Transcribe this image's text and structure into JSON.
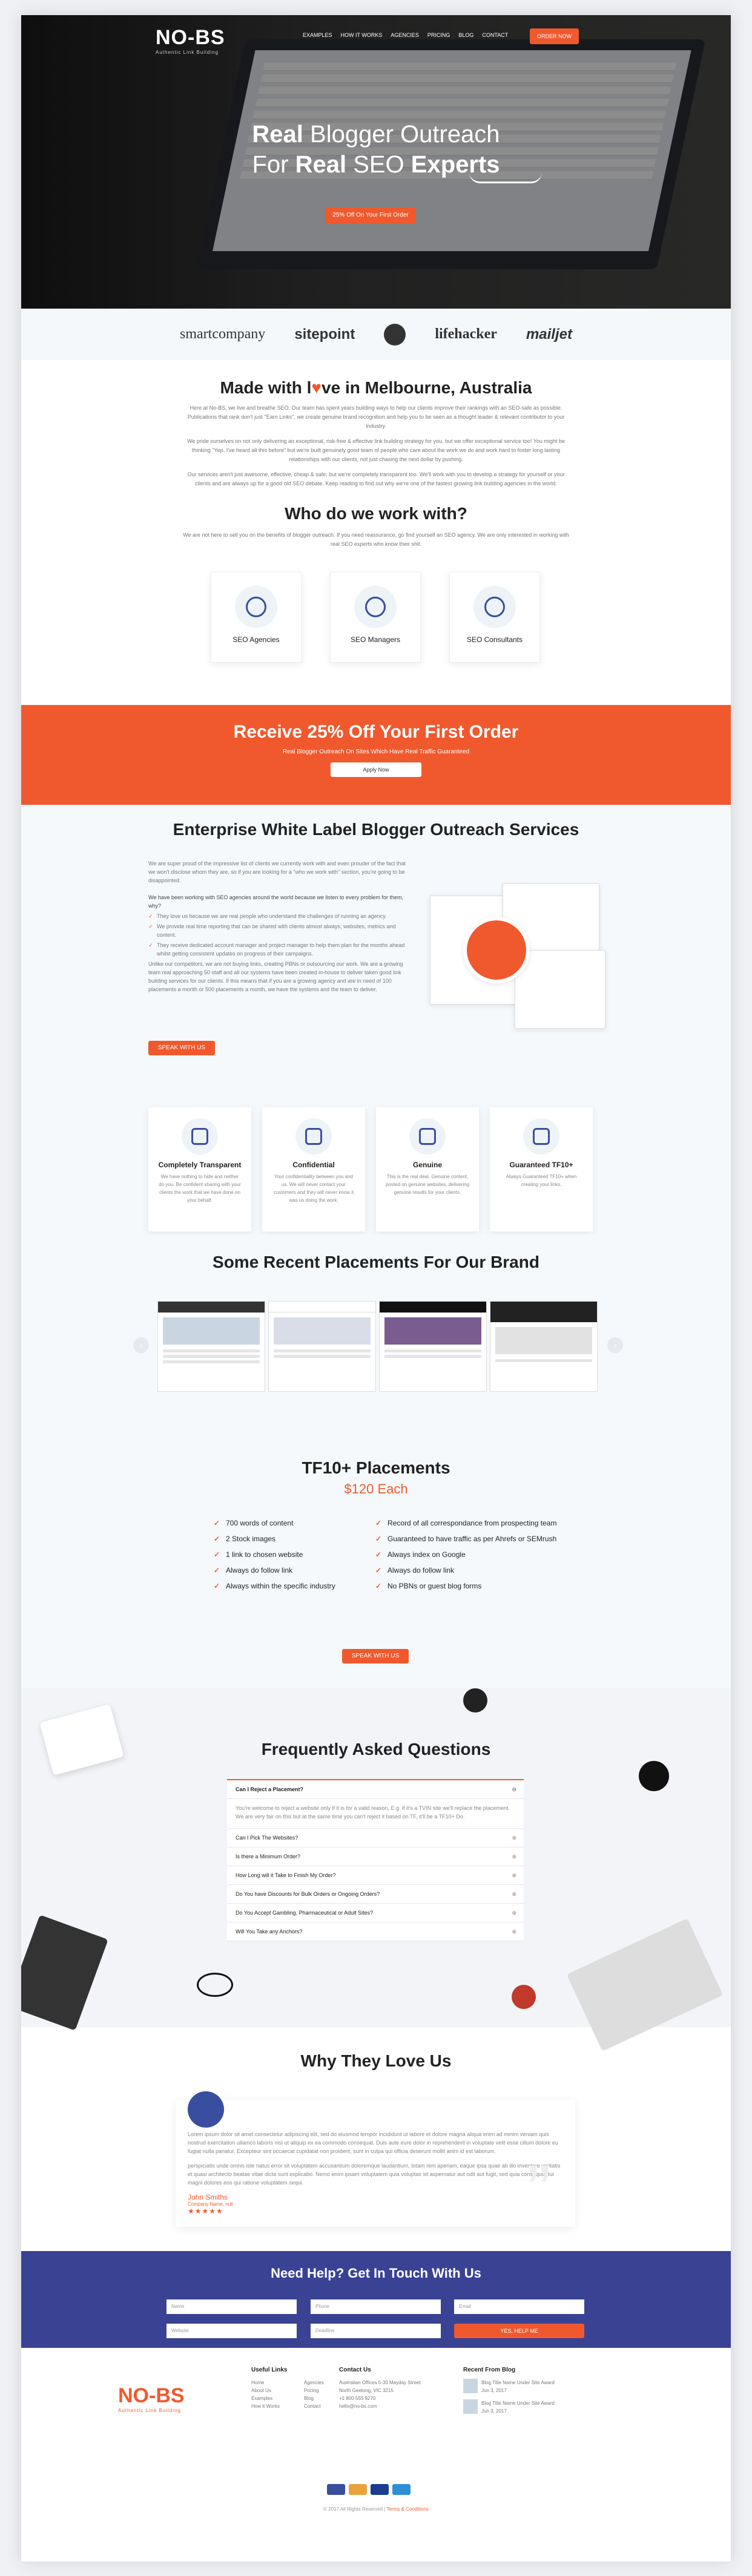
{
  "header": {
    "logo": "NO-BS",
    "logo_tag": "Authentic Link Building",
    "nav": [
      "EXAMPLES",
      "HOW IT WORKS",
      "AGENCIES",
      "PRICING",
      "BLOG",
      "CONTACT"
    ],
    "order_button": "ORDER NOW"
  },
  "hero": {
    "line1_bold": "Real",
    "line1_rest": " Blogger Outreach",
    "line2_pre": "For ",
    "line2_bold1": "Real",
    "line2_mid": " SEO ",
    "line2_bold2": "Experts",
    "cta": "25% Off On Your First Order"
  },
  "press_logos": [
    "smartcompany",
    "sitepoint",
    "lifehacker",
    "mailjet"
  ],
  "about": {
    "title_pre": "Made with l",
    "title_heart": "♥",
    "title_post": "ve in Melbourne, Australia",
    "p1": "Here at No-BS, we live and breathe SEO. Our team has spent years building ways to help our clients improve their rankings with an SEO-safe as possible. Publications that rank don't just \"Earn Links\", we create genuine brand recognition and help you to be seen as a thought leader & relevant contributor to your industry.",
    "p2": "We pride ourselves on not only delivering an exceptional, risk-free & effective link building strategy for you, but we offer exceptional service too! You might be thinking \"Yep, I've heard all this before\" but we're built genuinely good team of people who care about the work we do and work hard to foster long lasting relationships with our clients, not just chasing the next dollar by pushing.",
    "p3": "Our services aren't just awesome, effective, cheap & safe; but we're completely transparent too. We'll work with you to develop a strategy for yourself or your clients and are always up for a good old SEO debate. Keep reading to find out why we're one of the fastest growing link building agencies in the world.",
    "who_title": "Who do we work with?",
    "who_sub": "We are not here to sell you on the benefits of blogger outreach. If you need reassurance, go find yourself an SEO agency. We are only interested in working with real SEO experts who know their shit."
  },
  "who_cards": [
    {
      "label": "SEO Agencies",
      "icon": "search-globe-icon"
    },
    {
      "label": "SEO Managers",
      "icon": "team-icon"
    },
    {
      "label": "SEO Consultants",
      "icon": "consultant-icon"
    }
  ],
  "discount": {
    "title": "Receive 25% Off Your First Order",
    "sub": "Real Blogger Outreach On Sites Which Have Real Traffic Guaranteed",
    "button": "Apply Now"
  },
  "enterprise": {
    "title": "Enterprise White Label Blogger Outreach Services",
    "p1": "We are super proud of the impressive list of clients we currently work with and even prouder of the fact that we won't disclose whom they are, so if you are looking for a \"who we work with\" section, you're going to be disappointed.",
    "p2": "We have been working with SEO agencies around the world because we listen to every problem for them, why?",
    "bullets": [
      "They love us because we are real people who understand the challenges of running an agency.",
      "We provide real time reporting that can be shared with clients almost always, websites, metrics and content.",
      "They receive dedicated account manager and project manager to help them plan for the months ahead whilst getting consistent updates on progress of their campaigns."
    ],
    "p3": "Unlike our competitors, we are not buying links, creating PBNs or outsourcing our work. We are a growing team real approaching 50 staff and all our systems have been created in-house to deliver taken good link building services for our clients. If this means that if you are a growing agency and are in need of 100 placements a month or 500 placements a month, we have the systems and the team to deliver.",
    "button": "SPEAK WITH US"
  },
  "features": [
    {
      "title": "Completely Transparent",
      "text": "We have nothing to hide and neither do you. Be confident sharing with your clients the work that we have done on your behalf.",
      "icon": "browser-icon"
    },
    {
      "title": "Confidential",
      "text": "Your confidentiality between you and us. We will never contact your customers and they will never know it was us doing the work.",
      "icon": "lock-icon"
    },
    {
      "title": "Genuine",
      "text": "This is the real deal. Genuine content, posted on genuine websites, delivering genuine results for your clients.",
      "icon": "target-icon"
    },
    {
      "title": "Guaranteed TF10+",
      "text": "Always Guaranteed TF10+ when creating your links.",
      "icon": "badge-icon"
    }
  ],
  "placements": {
    "title": "Some Recent Placements For Our Brand",
    "prev": "‹",
    "next": "›"
  },
  "tf10": {
    "title": "TF10+ Placements",
    "price": "$120 Each",
    "left": [
      "700 words of content",
      "2 Stock images",
      "1 link to chosen website",
      "Always do follow link",
      "Always within the specific industry"
    ],
    "right": [
      "Record of all correspondance from prospecting team",
      "Guaranteed to have traffic as per Ahrefs or SEMrush",
      "Always index on Google",
      "Always do follow link",
      "No PBNs or guest blog forms"
    ],
    "button": "SPEAK WITH US"
  },
  "faq": {
    "title": "Frequently Asked Questions",
    "open_q": "Can I Reject a Placement?",
    "open_a": "You're welcome to reject a website only if it is for a valid reason, E.g. if it's a TVIN site we'll replace the placement. We are very fair on this but at the same time you can't reject it based on TF, it'll be a TF10+ Do.",
    "questions": [
      "Can I Pick The Websites?",
      "Is there a Minimum Order?",
      "How Long will it Take to Finish My Order?",
      "Do You have Discounts for Bulk Orders or Ongoing Orders?",
      "Do You Accept Gambling, Pharmaceutical or Adult Sites?",
      "Will You Take any Anchors?"
    ]
  },
  "testimonial": {
    "title": "Why They Love Us",
    "p1": "Lorem ipsum dolor sit amet consectetur adipiscing elit, sed do eiusmod tempor incididunt ut labore et dolore magna aliqua enim ad minim veniam quis nostrud exercitation ullamco laboris nisi ut aliquip ex ea commodo consequat. Duis aute irure dolor in reprehenderit in voluptate velit esse cillum dolore eu fugiat nulla pariatur. Excepteur sint occaecat cupidatat non proident, sunt in culpa qui officia deserunt mollit anim id est laborum.",
    "p2": "perspiciatis unde omnis iste natus error sit voluptatem accusantium doloremque laudantium, totam rem aperiam, eaque ipsa quae ab illo inventore veritatis et quasi architecto beatae vitae dicta sunt explicabo. Nemo enim ipsam voluptatem quia voluptas sit aspernatur aut odit aut fugit, sed quia consequuntur magni dolores eos qui ratione voluptatem sequi.",
    "name": "John Smiths",
    "role": "Company Name, null",
    "stars": "★★★★★"
  },
  "contact": {
    "title": "Need Help? Get In Touch With Us",
    "fields": [
      "Name",
      "Phone",
      "Email",
      "Website",
      "Deadline"
    ],
    "button": "YES, HELP ME"
  },
  "footer": {
    "logo": "NO-BS",
    "logo_tag": "Authentic Link Building",
    "useful_title": "Useful Links",
    "useful_a": [
      "Home",
      "About Us",
      "Examples",
      "How it Works"
    ],
    "useful_b": [
      "Agencies",
      "Pricing",
      "Blog",
      "Contact"
    ],
    "contact_title": "Contact Us",
    "contact_lines": [
      "Australian Offices 5-30 Mayday Street",
      "North Geelong, VIC 3215",
      "+1 800 555 9270",
      "hello@no-bs.com"
    ],
    "blog_title": "Recent From Blog",
    "blog_posts": [
      "Blog Title Name Under Site Award",
      "Blog Title Name Under Site Award"
    ],
    "blog_dates": [
      "Jun 3, 2017",
      "Jun 3, 2017"
    ],
    "copyright": "© 2017 All Rights Reserved",
    "terms": "Terms & Conditions"
  }
}
